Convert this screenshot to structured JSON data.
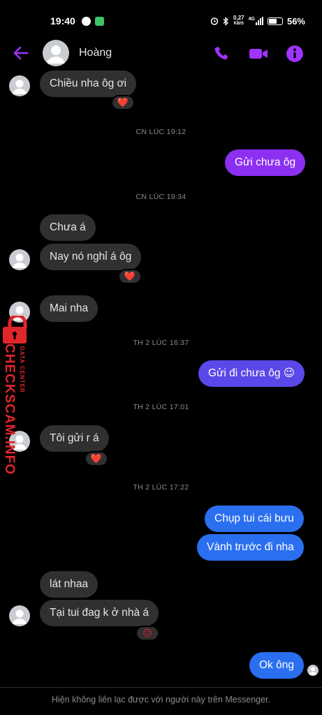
{
  "status_bar": {
    "time": "19:40",
    "net_speed_value": "0,27",
    "net_speed_unit": "KB/S",
    "network": "4G",
    "battery": "56%"
  },
  "header": {
    "contact_name": "Hoàng",
    "icons": [
      "back-arrow-icon",
      "phone-icon",
      "video-icon",
      "info-icon"
    ]
  },
  "messages": [
    {
      "text": "Chiều nha ôg ơi",
      "direction": "in",
      "reaction": "❤️"
    },
    {
      "timestamp": "CN LÚC 19:12"
    },
    {
      "text": "Gửi chưa ôg",
      "direction": "out"
    },
    {
      "timestamp": "CN LÚC 19:34"
    },
    {
      "text": "Chưa á",
      "direction": "in"
    },
    {
      "text": "Nay nó nghỉ á ôg",
      "direction": "in",
      "reaction": "❤️"
    },
    {
      "text": "Mai nha",
      "direction": "in"
    },
    {
      "timestamp": "TH 2 LÚC 16:37"
    },
    {
      "text": "Gửi đi chưa ôg 😉",
      "direction": "out"
    },
    {
      "timestamp": "TH 2 LÚC 17:01"
    },
    {
      "text": "Tôi gửi r á",
      "direction": "in",
      "reaction": "❤️"
    },
    {
      "timestamp": "TH 2 LÚC 17:22"
    },
    {
      "text": "Chụp tui cái bưu",
      "direction": "out"
    },
    {
      "text": "Vành trước đi nha",
      "direction": "out"
    },
    {
      "text": "lát nhaa",
      "direction": "in"
    },
    {
      "text": "Tại tui đag k ở nhà á",
      "direction": "in",
      "reaction": "😥"
    },
    {
      "text": "Ok ông",
      "direction": "out"
    }
  ],
  "watermark": {
    "main": "CHECKSCAM.INFO",
    "sub": "DATA CENTER"
  },
  "footer": {
    "notice": "Hiện không liên lạc được với người này trên Messenger."
  },
  "colors": {
    "accent": "#a033ff",
    "outgoing_purple": "#8c2ff0",
    "outgoing_blue": "#2a6ff0",
    "incoming": "#303030",
    "watermark": "#e0262a"
  }
}
